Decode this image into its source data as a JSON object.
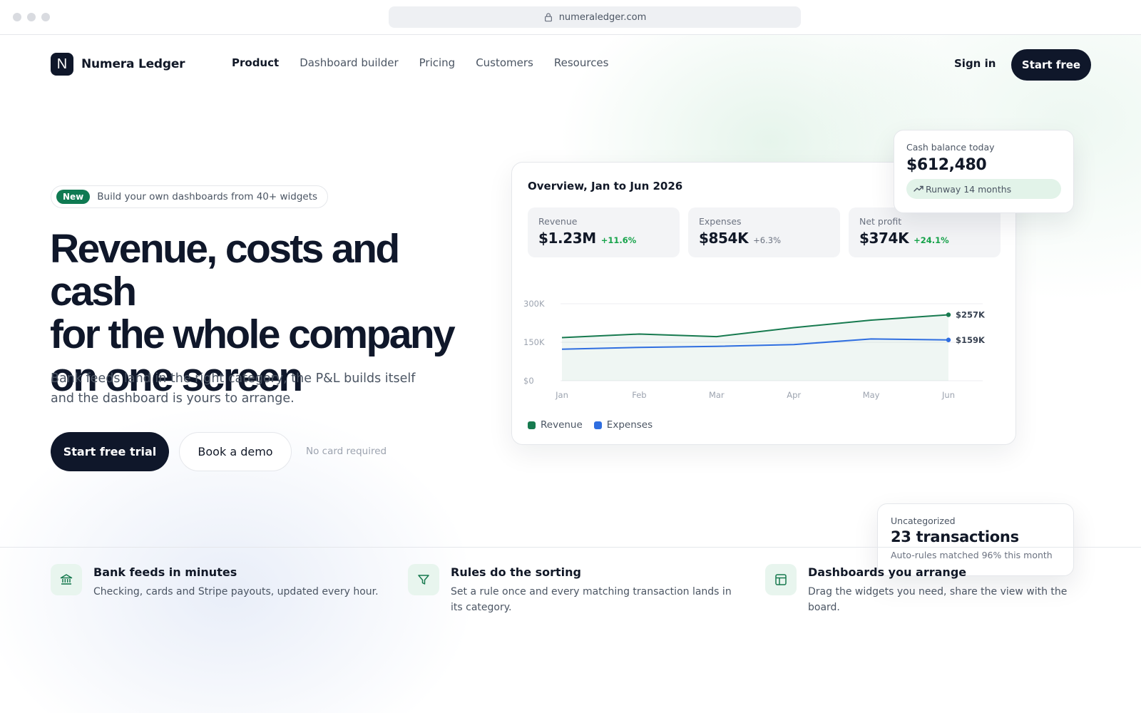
{
  "browser": {
    "url": "numeraledger.com"
  },
  "brand": {
    "logo_letter": "N",
    "name": "Numera Ledger"
  },
  "nav": {
    "items": [
      "Product",
      "Dashboard builder",
      "Pricing",
      "Customers",
      "Resources"
    ],
    "sign_in": "Sign in",
    "start_free": "Start free"
  },
  "hero": {
    "badge": "New",
    "announcement": "Build your own dashboards from 40+ widgets",
    "headline_lines": [
      "Revenue, costs and cash",
      "for the whole company",
      "on one screen"
    ],
    "subtext": "Bank feeds land in the right category, the P&L builds itself and the dashboard is yours to arrange.",
    "cta_primary": "Start free trial",
    "cta_secondary": "Book a demo",
    "note": "No card required"
  },
  "overview": {
    "title": "Overview, Jan to Jun 2026",
    "kpis": [
      {
        "label": "Revenue",
        "value": "$1.23M",
        "change": "+11.6%",
        "trend": "up"
      },
      {
        "label": "Expenses",
        "value": "$854K",
        "change": "+6.3%",
        "trend": "neutral"
      },
      {
        "label": "Net profit",
        "value": "$374K",
        "change": "+24.1%",
        "trend": "up"
      }
    ]
  },
  "chart_data": {
    "type": "line",
    "title": "",
    "xlabel": "",
    "ylabel": "",
    "x": [
      "Jan",
      "Feb",
      "Mar",
      "Apr",
      "May",
      "Jun"
    ],
    "y_ticks": [
      "$0",
      "150K",
      "300K"
    ],
    "ylim": [
      0,
      300000
    ],
    "series": [
      {
        "name": "Revenue",
        "color": "#177a4f",
        "values": [
          168000,
          182000,
          172000,
          207000,
          236000,
          257000
        ],
        "end_label": "$257K"
      },
      {
        "name": "Expenses",
        "color": "#2f6ee0",
        "values": [
          123000,
          130000,
          134000,
          141000,
          163000,
          159000
        ],
        "end_label": "$159K"
      }
    ],
    "area_under": "Revenue",
    "grid": true,
    "legend": "bottom-left"
  },
  "cash_card": {
    "label": "Cash balance today",
    "value": "$612,480",
    "runway": "Runway 14 months"
  },
  "uncategorized_card": {
    "label": "Uncategorized",
    "value": "23 transactions",
    "note": "Auto-rules matched 96% this month"
  },
  "features": [
    {
      "icon": "bank-icon",
      "title": "Bank feeds in minutes",
      "desc": "Checking, cards and Stripe payouts, updated every hour."
    },
    {
      "icon": "filter-icon",
      "title": "Rules do the sorting",
      "desc": "Set a rule once and every matching transaction lands in its category."
    },
    {
      "icon": "layout-icon",
      "title": "Dashboards you arrange",
      "desc": "Drag the widgets you need, share the view with the board."
    }
  ],
  "colors": {
    "accent": "#0f7a52",
    "dark": "#0f172a",
    "revenue": "#177a4f",
    "expenses": "#2f6ee0"
  }
}
